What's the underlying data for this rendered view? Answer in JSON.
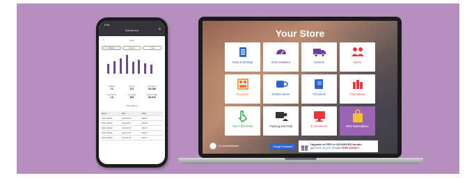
{
  "colors": {
    "banner_bg": "#b78ec0",
    "tile_featured": "#9a66b4",
    "blue_icon": "#2f62c9",
    "red_icon": "#e03a3e",
    "orange_icon": "#ee7a23",
    "purple_icon": "#6b3f99",
    "green_text": "#2d9a3c",
    "button_blue": "#2a68c9"
  },
  "phone": {
    "status_time": "9:41",
    "header_title": "Dashboard",
    "subtitle": "Sales",
    "toggles": [
      "Week",
      "Month",
      "Year"
    ],
    "chart_bars": [
      0.5,
      0.65,
      0.8,
      0.95,
      0.6,
      0.7,
      0.55,
      0.45
    ],
    "stats": [
      {
        "label": "Orders",
        "value": "73"
      },
      {
        "label": "Items",
        "value": "147"
      },
      {
        "label": "Net Sales",
        "value": "$3,436"
      },
      {
        "label": "Avg Items",
        "value": "1.8"
      },
      {
        "label": "Avg Sale",
        "value": "$45"
      },
      {
        "label": "Gross Sales",
        "value": "$3,613"
      }
    ],
    "link_text": "View Report",
    "table_head": [
      "Name",
      "Date",
      "Total"
    ],
    "table_rows": [
      [
        "Order #10234",
        "10/23 09:12",
        "$45.00"
      ],
      [
        "Order #10233",
        "10/23 08:57",
        "$22.50"
      ],
      [
        "Order #10232",
        "10/22 16:40",
        "$61.20"
      ],
      [
        "Order #10231",
        "10/22 14:05",
        "$18.75"
      ],
      [
        "Order #10230",
        "10/22 11:30",
        "$33.10"
      ]
    ]
  },
  "laptop": {
    "store_title": "Your Store",
    "tiles": [
      {
        "label": "Tools & Settings",
        "icon": "tools-icon",
        "color": "#2f62c9"
      },
      {
        "label": "Store Statistics",
        "icon": "speedometer-icon",
        "color": "#6b3f99"
      },
      {
        "label": "Vendors",
        "icon": "truck-icon",
        "color": "#6b3f99"
      },
      {
        "label": "Users",
        "icon": "users-icon",
        "color": "#e03a3e"
      },
      {
        "label": "Inventory",
        "icon": "inventory-icon",
        "color": "#ee7a23"
      },
      {
        "label": "Kitchen Items",
        "icon": "coffee-cup-icon",
        "color": "#2f62c9"
      },
      {
        "label": "Pricebook",
        "icon": "book-icon",
        "color": "#2f62c9"
      },
      {
        "label": "Promotions",
        "icon": "promotions-icon",
        "color": "#e03a3e"
      },
      {
        "label": "One Click Items",
        "icon": "pointer-click-icon",
        "color": "#2d9a3c"
      },
      {
        "label": "Training and Help",
        "icon": "training-icon",
        "color": "#333333"
      },
      {
        "label": "E-commerce",
        "icon": "ecommerce-icon",
        "color": "#e03a3e"
      },
      {
        "label": "NRS Marketplace",
        "icon": "shopping-bag-icon",
        "color": "#f2c230"
      }
    ],
    "admin_name": "Hi, Administrator",
    "change_password": "Change Password",
    "upgrade_line1": "Upgrade to PRO or ADVANCED bundle",
    "upgrade_line2_a": "and",
    "upgrade_line2_hl": "SAVE 25-40% ON",
    "upgrade_line2_b": "fees",
    "upgrade_line2_red": "FREE MONEY!",
    "brand": "MacBook Pro"
  }
}
